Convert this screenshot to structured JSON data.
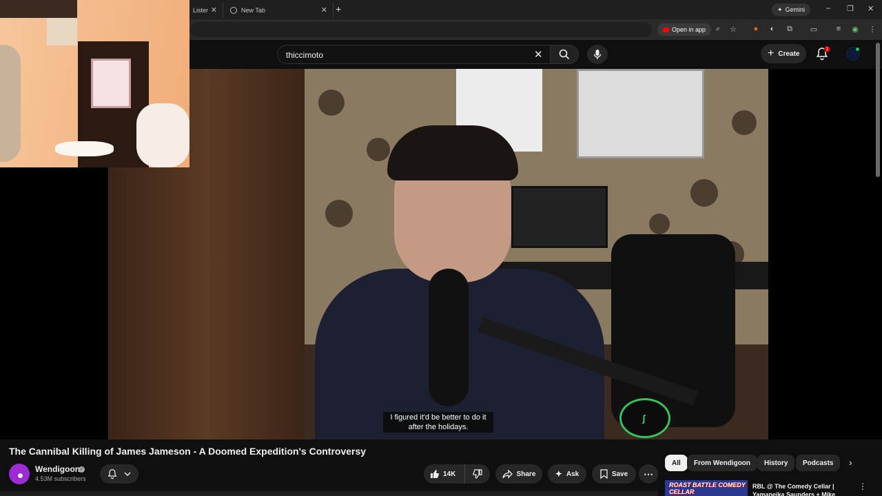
{
  "browser": {
    "tabs": [
      {
        "label": "Lister",
        "partial": true
      },
      {
        "label": "New Tab",
        "partial": false
      }
    ],
    "gemini_label": "Gemini",
    "open_in_app_label": "Open in app"
  },
  "header": {
    "search_value": "thiccimoto",
    "create_label": "Create",
    "notification_count": "1"
  },
  "video": {
    "caption_line1": "I figured it'd be better to do it",
    "caption_line2": "after the holidays."
  },
  "watch": {
    "title": "The Cannibal Killing of James Jameson - A Doomed Expedition's Controversy",
    "channel_name": "Wendigoon",
    "subscribers": "4.53M subscribers",
    "like_count": "14K",
    "share_label": "Share",
    "ask_label": "Ask",
    "save_label": "Save"
  },
  "chips": [
    {
      "label": "All",
      "active": true
    },
    {
      "label": "From Wendigoon",
      "active": false
    },
    {
      "label": "History",
      "active": false
    },
    {
      "label": "Podcasts",
      "active": false
    }
  ],
  "recommendation": {
    "thumb_text": "ROAST BATTLE COMEDY CELLAR",
    "title": "RBL @ The Comedy Cellar | Yamaneika Saunders + Mike"
  },
  "colors": {
    "background": "#0f0f0f",
    "surface": "#272727",
    "youtube_red": "#ff0000",
    "notification_red": "#cc0000",
    "channel_avatar": "#9a2bd6"
  },
  "icons": [
    "search-icon",
    "mic-icon",
    "plus-icon",
    "bell-icon",
    "like-icon",
    "dislike-icon",
    "share-icon",
    "sparkle-icon",
    "bookmark-icon",
    "more-icon",
    "chevron-right-icon",
    "close-icon"
  ]
}
